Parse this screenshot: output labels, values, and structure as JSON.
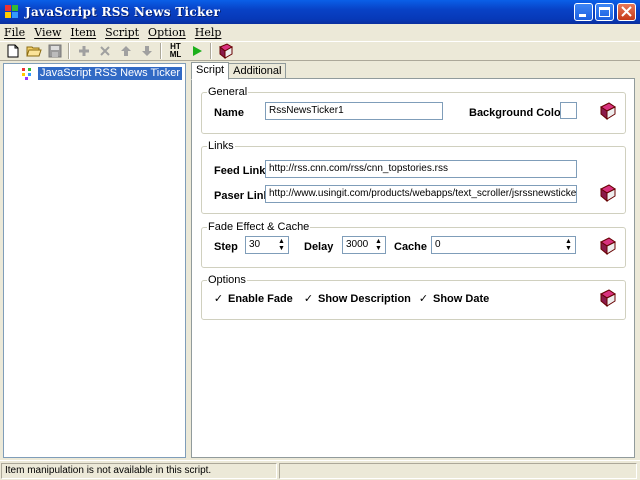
{
  "window": {
    "title": "JavaScript RSS News Ticker"
  },
  "menu": [
    "File",
    "View",
    "Item",
    "Script",
    "Option",
    "Help"
  ],
  "toolbar": {
    "html_label": "HT\nML"
  },
  "tree": {
    "root_label": "JavaScript RSS News Ticker"
  },
  "tabs": [
    "Script",
    "Additional"
  ],
  "general": {
    "legend": "General",
    "name_label": "Name",
    "name_value": "RssNewsTicker1",
    "bgcolor_label": "Background Color"
  },
  "links": {
    "legend": "Links",
    "feed_label": "Feed Link",
    "feed_value": "http://rss.cnn.com/rss/cnn_topstories.rss",
    "parser_label": "Paser Link",
    "parser_value": "http://www.usingit.com/products/webapps/text_scroller/jsrssnewsticker/rssparse"
  },
  "fade": {
    "legend": "Fade Effect & Cache",
    "step_label": "Step",
    "step_value": "30",
    "delay_label": "Delay",
    "delay_value": "3000",
    "cache_label": "Cache",
    "cache_value": "0"
  },
  "options": {
    "legend": "Options",
    "enable_fade": "Enable Fade",
    "show_description": "Show Description",
    "show_date": "Show Date"
  },
  "status": {
    "message": "Item manipulation is not available in this script."
  },
  "colors": {
    "title_blue": "#0842c6",
    "selection": "#316ac5",
    "face": "#ece9d8"
  }
}
